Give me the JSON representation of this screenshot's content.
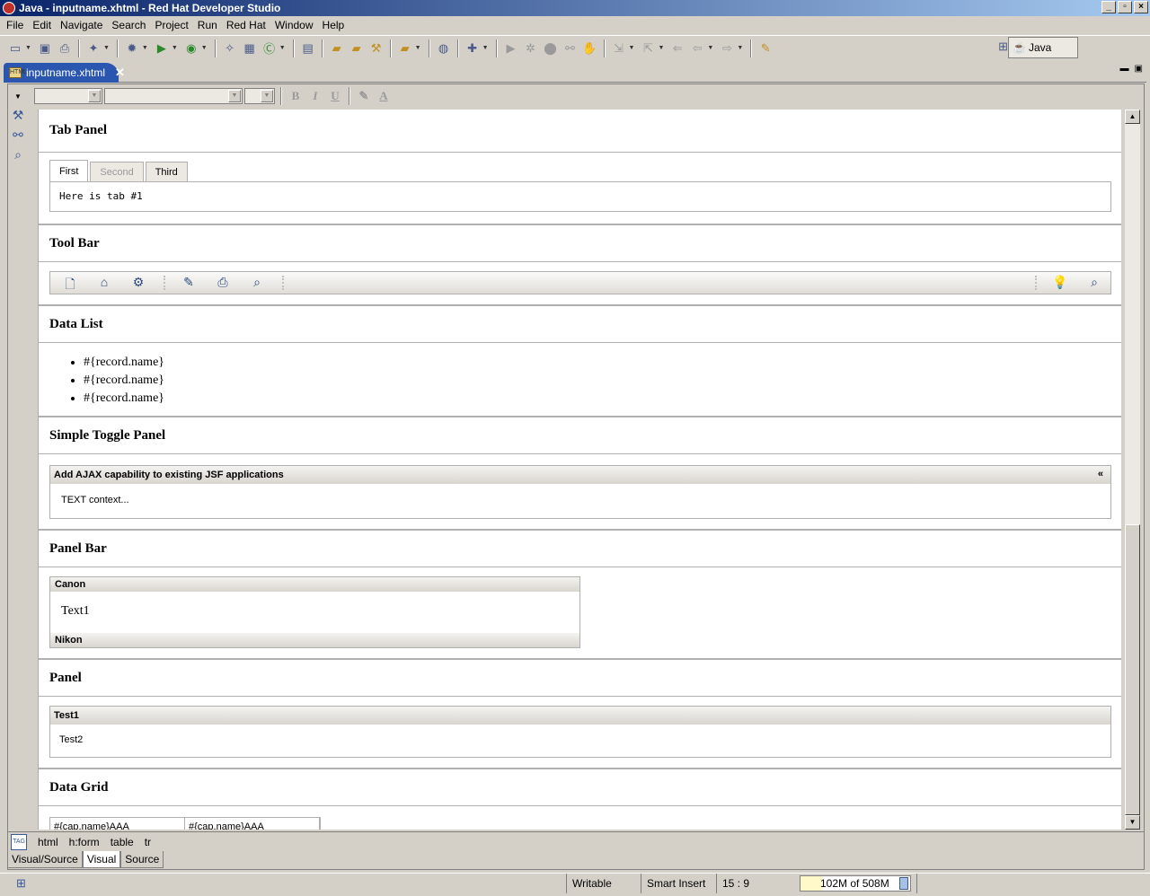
{
  "window": {
    "title": "Java - inputname.xhtml - Red Hat Developer Studio",
    "controls": [
      "_",
      "▫",
      "×"
    ]
  },
  "menu": [
    "File",
    "Edit",
    "Navigate",
    "Search",
    "Project",
    "Run",
    "Red Hat",
    "Window",
    "Help"
  ],
  "perspective": {
    "label": "Java"
  },
  "editor": {
    "tab_label": "inputname.xhtml",
    "file_icon_text": "HTML"
  },
  "format_buttons": [
    "B",
    "I",
    "U"
  ],
  "sections": {
    "tab_panel": {
      "title": "Tab Panel",
      "tabs": [
        "First",
        "Second",
        "Third"
      ],
      "content": "Here is tab #1"
    },
    "tool_bar": {
      "title": "Tool Bar"
    },
    "data_list": {
      "title": "Data List",
      "items": [
        "#{record.name}",
        "#{record.name}",
        "#{record.name}"
      ]
    },
    "toggle_panel": {
      "title": "Simple Toggle Panel",
      "header": "Add AJAX capability to existing JSF applications",
      "chevron": "«",
      "body": "TEXT context..."
    },
    "panel_bar": {
      "title": "Panel Bar",
      "items": [
        "Canon",
        "Nikon"
      ],
      "content": "Text1"
    },
    "panel": {
      "title": "Panel",
      "header": "Test1",
      "body": "Test2"
    },
    "data_grid": {
      "title": "Data Grid",
      "cells": [
        "#{cap.name}AAA",
        "#{cap.name}AAA"
      ]
    }
  },
  "breadcrumb": {
    "icon_text": "TAG",
    "items": [
      "html",
      "h:form",
      "table",
      "tr"
    ]
  },
  "view_tabs": [
    "Visual/Source",
    "Visual",
    "Source"
  ],
  "status": {
    "writable": "Writable",
    "insert_mode": "Smart Insert",
    "position": "15 : 9",
    "heap": "102M of 508M",
    "heap_used_fraction": 0.2
  }
}
